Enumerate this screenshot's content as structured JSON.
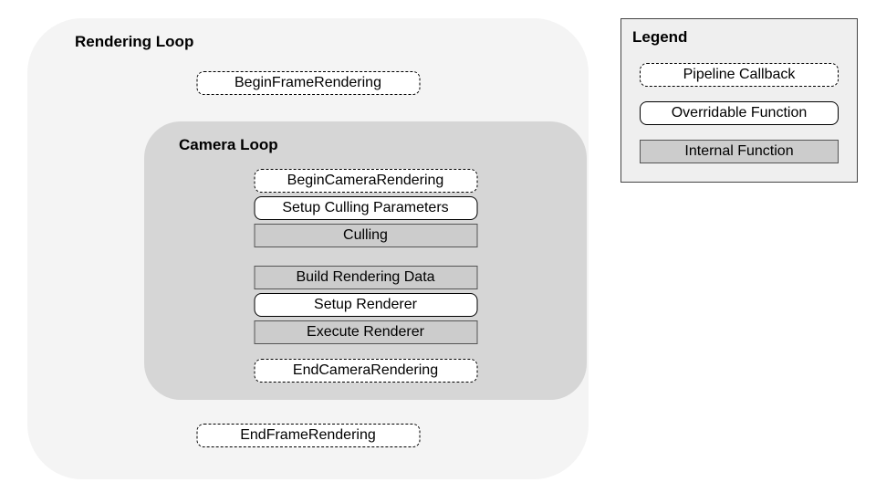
{
  "renderingLoop": {
    "title": "Rendering Loop",
    "beginFrame": "BeginFrameRendering",
    "endFrame": "EndFrameRendering"
  },
  "cameraLoop": {
    "title": "Camera Loop",
    "steps": {
      "beginCamera": "BeginCameraRendering",
      "setupCulling": "Setup Culling Parameters",
      "culling": "Culling",
      "buildData": "Build Rendering Data",
      "setupRenderer": "Setup Renderer",
      "executeRenderer": "Execute Renderer",
      "endCamera": "EndCameraRendering"
    }
  },
  "legend": {
    "title": "Legend",
    "callback": "Pipeline Callback",
    "overridable": "Overridable Function",
    "internal": "Internal Function"
  },
  "colors": {
    "outerBg": "#f4f4f4",
    "innerBg": "#d6d6d6",
    "internalFill": "#cccccc",
    "legendBg": "#efefef"
  }
}
